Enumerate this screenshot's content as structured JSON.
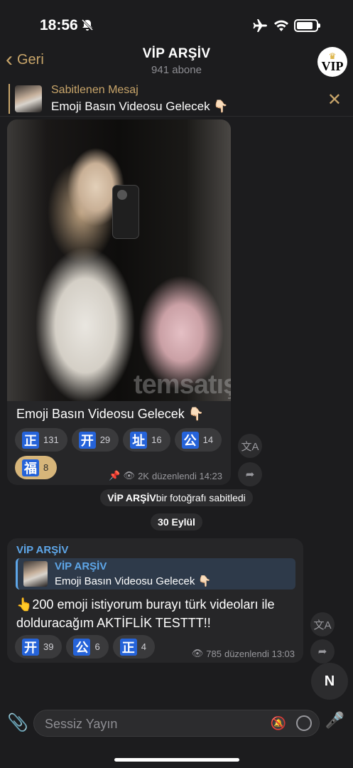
{
  "status_bar": {
    "time": "18:56"
  },
  "header": {
    "back_label": "Geri",
    "title": "VİP ARŞİV",
    "subtitle": "941 abone",
    "avatar_text": "VIP"
  },
  "pinned": {
    "title": "Sabitlenen Mesaj",
    "text": "Emoji Basın Videosu Gelecek 👇🏻"
  },
  "post1": {
    "watermark": "temsatış",
    "text": "Emoji Basın Videosu Gelecek 👇🏻",
    "reactions": [
      {
        "emoji": "正",
        "count": "131",
        "active": false
      },
      {
        "emoji": "开",
        "count": "29",
        "active": false
      },
      {
        "emoji": "址",
        "count": "16",
        "active": false
      },
      {
        "emoji": "公",
        "count": "14",
        "active": false
      },
      {
        "emoji": "福",
        "count": "8",
        "active": true
      }
    ],
    "views": "2K",
    "edited_time": "düzenlendi 14:23"
  },
  "service": {
    "actor": "VİP ARŞİV",
    "action": " bir fotoğrafı sabitledi"
  },
  "date_chip": "30 Eylül",
  "post2": {
    "sender": "VİP ARŞİV",
    "reply_name": "VİP ARŞİV",
    "reply_text": "Emoji Basın Videosu Gelecek 👇🏻",
    "text": "👆200 emoji istiyorum burayı türk videoları ile dolduracağım AKTİFLİK TESTTT!!",
    "reactions": [
      {
        "emoji": "开",
        "count": "39"
      },
      {
        "emoji": "公",
        "count": "6"
      },
      {
        "emoji": "正",
        "count": "4"
      }
    ],
    "views": "785",
    "edited_time": "düzenlendi 13:03"
  },
  "input": {
    "placeholder": "Sessiz Yayın"
  }
}
